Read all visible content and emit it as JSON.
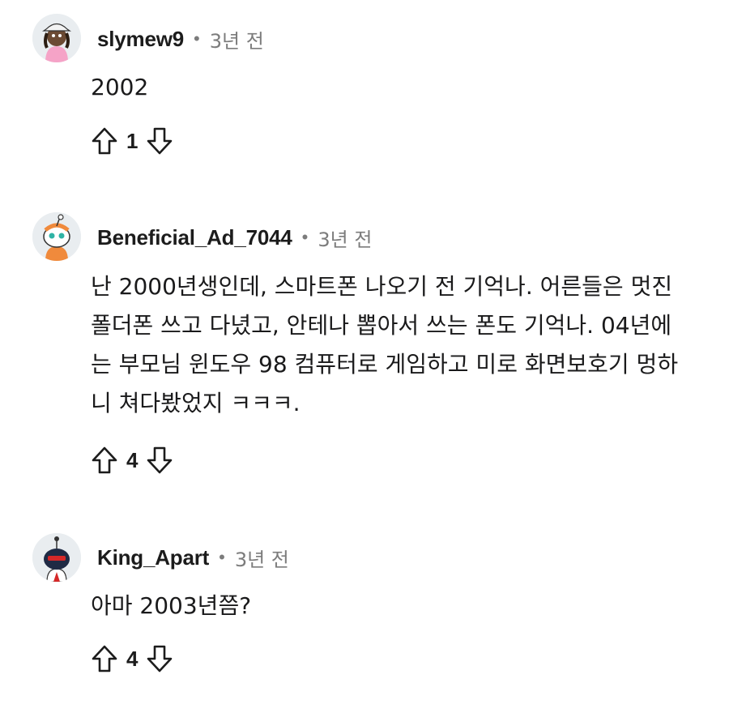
{
  "comments": [
    {
      "author": "slymew9",
      "separator": "•",
      "time": "3년 전",
      "body": "2002",
      "score": "1",
      "avatar_icon": "snoo-avatar-pink-icon"
    },
    {
      "author": "Beneficial_Ad_7044",
      "separator": "•",
      "time": "3년 전",
      "body": "난 2000년생인데, 스마트폰 나오기 전 기억나. 어른들은 멋진 폴더폰 쓰고 다녔고, 안테나 뽑아서 쓰는 폰도 기억나. 04년에는 부모님 윈도우 98 컴퓨터로 게임하고 미로 화면보호기 멍하니 쳐다봤었지 ㅋㅋㅋ.",
      "score": "4",
      "avatar_icon": "snoo-avatar-orange-icon"
    },
    {
      "author": "King_Apart",
      "separator": "•",
      "time": "3년 전",
      "body": "아마 2003년쯤?",
      "score": "4",
      "avatar_icon": "snoo-avatar-dark-icon"
    }
  ],
  "icons": {
    "upvote": "upvote-arrow-icon",
    "downvote": "downvote-arrow-icon"
  },
  "colors": {
    "text": "#1a1a1b",
    "meta": "#7c7c7c"
  }
}
